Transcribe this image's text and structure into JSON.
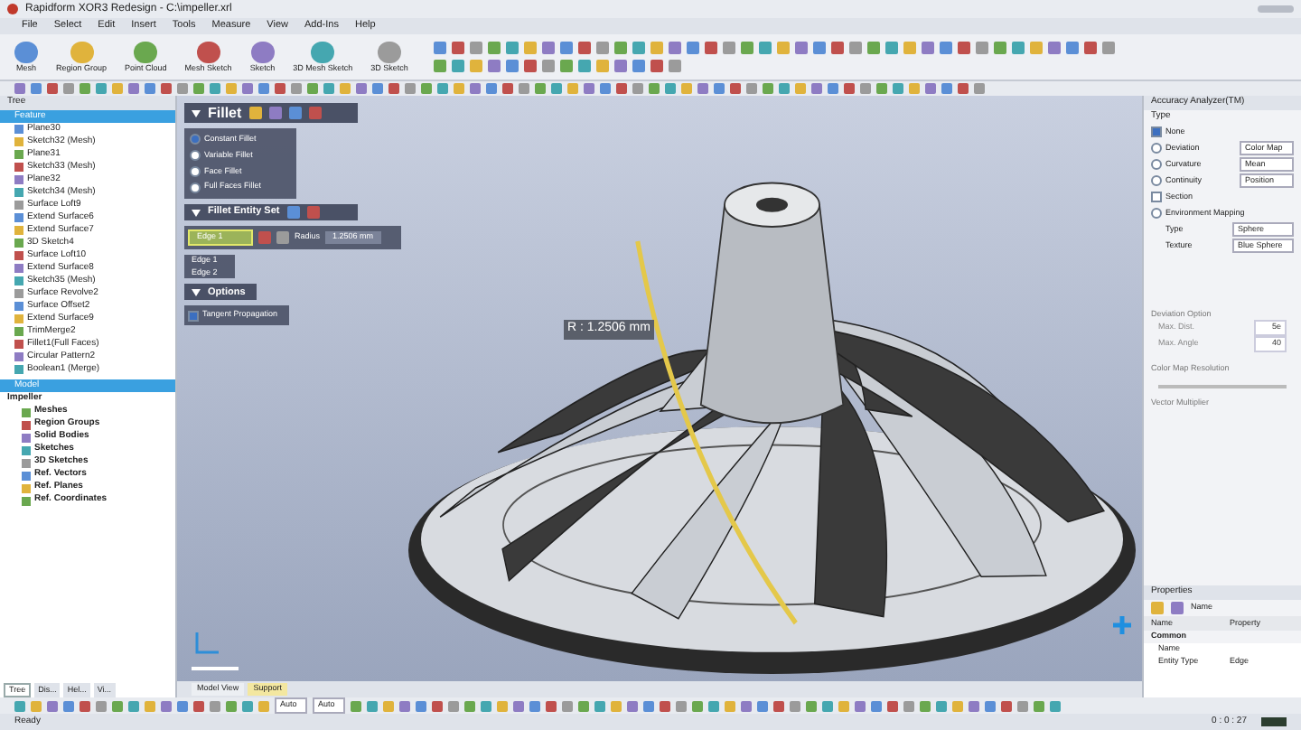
{
  "window": {
    "title": "Rapidform XOR3 Redesign - C:\\impeller.xrl"
  },
  "menu": [
    "File",
    "Select",
    "Edit",
    "Insert",
    "Tools",
    "Measure",
    "View",
    "Add-Ins",
    "Help"
  ],
  "ribbon": [
    {
      "label": "Mesh"
    },
    {
      "label": "Region Group"
    },
    {
      "label": "Point Cloud"
    },
    {
      "label": "Mesh Sketch"
    },
    {
      "label": "Sketch"
    },
    {
      "label": "3D Mesh Sketch"
    },
    {
      "label": "3D Sketch"
    }
  ],
  "tree": {
    "title": "Tree",
    "feature": {
      "title": "Feature",
      "items": [
        "Plane30",
        "Sketch32 (Mesh)",
        "Plane31",
        "Sketch33 (Mesh)",
        "Plane32",
        "Sketch34 (Mesh)",
        "Surface Loft9",
        "Extend Surface6",
        "Extend Surface7",
        "3D Sketch4",
        "Surface Loft10",
        "Extend Surface8",
        "Sketch35 (Mesh)",
        "Surface Revolve2",
        "Surface Offset2",
        "Extend Surface9",
        "TrimMerge2",
        "Fillet1(Full Faces)",
        "Circular Pattern2",
        "Boolean1 (Merge)"
      ]
    },
    "model": {
      "title": "Model",
      "root": "Impeller",
      "items": [
        "Meshes",
        "Region Groups",
        "Solid Bodies",
        "Sketches",
        "3D Sketches",
        "Ref. Vectors",
        "Ref. Planes",
        "Ref. Coordinates"
      ]
    }
  },
  "fillet": {
    "title": "Fillet",
    "methods": [
      {
        "label": "Constant Fillet",
        "selected": true
      },
      {
        "label": "Variable Fillet",
        "selected": false
      },
      {
        "label": "Face Fillet",
        "selected": false
      },
      {
        "label": "Full Faces Fillet",
        "selected": false
      }
    ],
    "entity_set": {
      "title": "Fillet Entity Set",
      "selected_edge": "Edge 1",
      "radius_label": "Radius",
      "radius": "1.2506 mm",
      "edges": [
        "Edge 1",
        "Edge 2"
      ]
    },
    "options": {
      "title": "Options",
      "items": [
        {
          "label": "Tangent Propagation",
          "checked": true
        }
      ]
    }
  },
  "viewport": {
    "dimension": "R : 1.2506 mm",
    "tabs": [
      {
        "label": "Model View",
        "selected": false
      },
      {
        "label": "Support",
        "selected": true
      }
    ]
  },
  "analyzer": {
    "title": "Accuracy Analyzer(TM)",
    "section": "Type",
    "options": [
      {
        "label": "None",
        "kind": "check",
        "checked": true
      },
      {
        "label": "Deviation",
        "kind": "radio",
        "checked": false,
        "value": "Color Map"
      },
      {
        "label": "Curvature",
        "kind": "radio",
        "checked": false,
        "value": "Mean"
      },
      {
        "label": "Continuity",
        "kind": "radio",
        "checked": false,
        "value": "Position"
      },
      {
        "label": "Section",
        "kind": "check",
        "checked": false
      },
      {
        "label": "Environment Mapping",
        "kind": "radio",
        "checked": false
      }
    ],
    "fields": [
      {
        "label": "Type",
        "value": "Sphere"
      },
      {
        "label": "Texture",
        "value": "Blue Sphere"
      }
    ],
    "groups": [
      "Deviation Option",
      "Color Map Resolution",
      "Vector Multiplier"
    ],
    "group_fields": [
      {
        "label": "Max. Dist.",
        "value": "5e"
      },
      {
        "label": "Max. Angle",
        "value": "40"
      }
    ]
  },
  "properties": {
    "title": "Properties",
    "sort": "Name",
    "columns": [
      "Name",
      "Property"
    ],
    "category": "Common",
    "rows": [
      {
        "name": "Name"
      },
      {
        "name": "Entity Type",
        "value": "Edge"
      }
    ]
  },
  "left_tabs": [
    {
      "label": "Tree",
      "selected": true
    },
    {
      "label": "Dis...",
      "selected": false
    },
    {
      "label": "Hel...",
      "selected": false
    },
    {
      "label": "Vi...",
      "selected": false
    }
  ],
  "bottom_toolbar": {
    "dropdowns": [
      "Auto",
      "Auto"
    ]
  },
  "status_bar": {
    "text": "Ready",
    "time": "0 : 0 : 27"
  }
}
